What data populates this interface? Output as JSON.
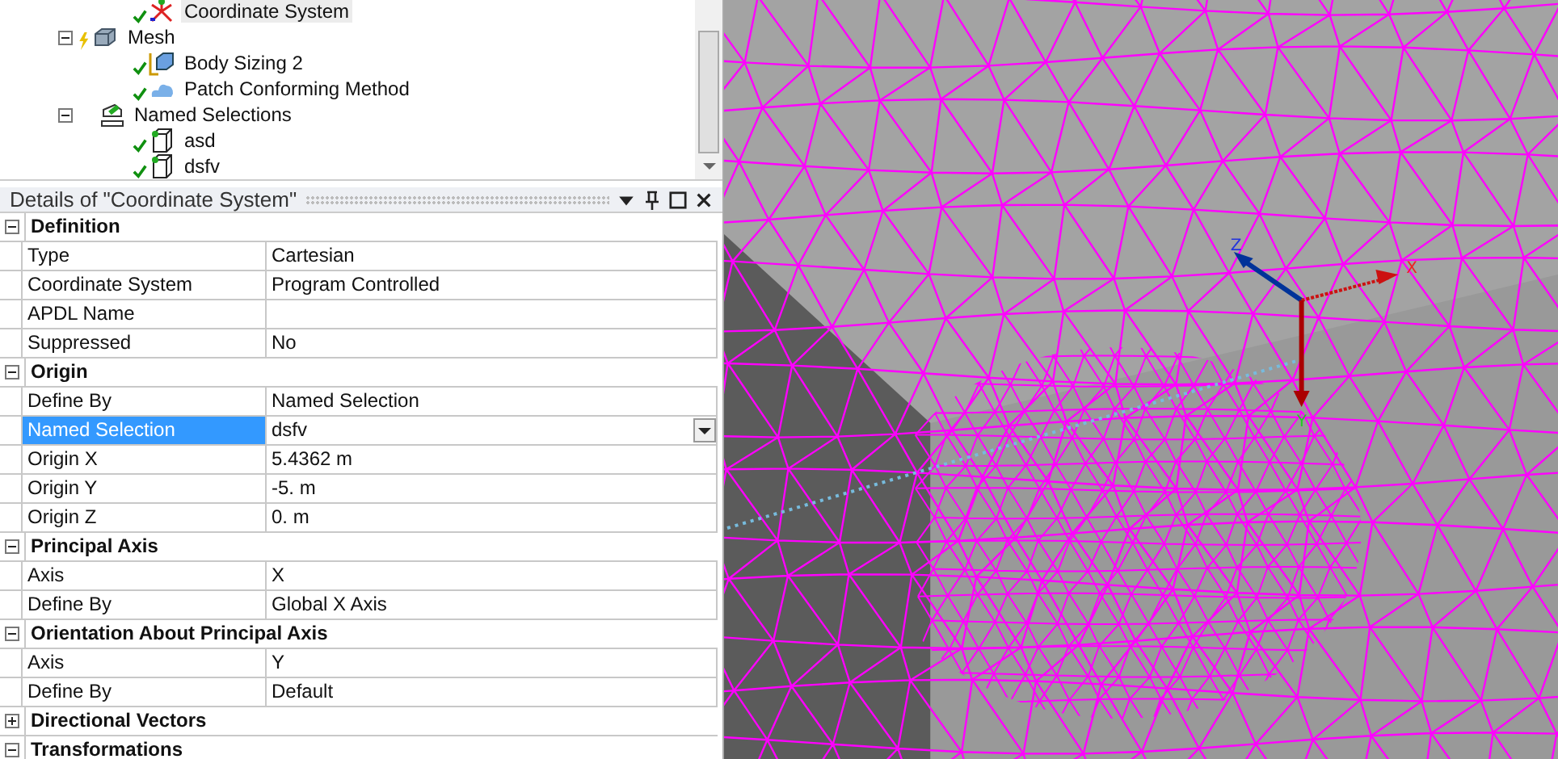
{
  "tree": {
    "items": [
      {
        "children": [
          {
            "label": "Coordinate System",
            "kind": "coordinate-system",
            "selected": true
          }
        ]
      },
      {
        "label": "Mesh",
        "kind": "mesh",
        "expanded": true,
        "selected": false,
        "children": [
          {
            "label": "Body Sizing 2",
            "kind": "sizing",
            "selected": false
          },
          {
            "label": "Patch Conforming Method",
            "kind": "method",
            "selected": false
          }
        ]
      },
      {
        "label": "Named Selections",
        "kind": "folder",
        "expanded": true,
        "selected": false,
        "children": [
          {
            "label": "asd",
            "kind": "selection",
            "selected": false
          },
          {
            "label": "dsfv",
            "kind": "selection",
            "selected": false
          }
        ]
      }
    ]
  },
  "details": {
    "title": "Details of \"Coordinate System\"",
    "rows": [
      {
        "kind": "group",
        "label": "Definition",
        "expanded": true
      },
      {
        "kind": "prop",
        "label": "Type",
        "value": "Cartesian",
        "selected": false
      },
      {
        "kind": "prop",
        "label": "Coordinate System",
        "value": "Program Controlled",
        "selected": false
      },
      {
        "kind": "prop",
        "label": "APDL Name",
        "selected": false
      },
      {
        "kind": "prop",
        "label": "Suppressed",
        "value": "No",
        "selected": false
      },
      {
        "kind": "group",
        "label": "Origin",
        "expanded": true
      },
      {
        "kind": "prop",
        "label": "Define By",
        "value": "Named Selection",
        "selected": false
      },
      {
        "kind": "dropdown",
        "label": "Named Selection",
        "value": "dsfv",
        "selected": true
      },
      {
        "kind": "prop",
        "label": "Origin X",
        "value": "5.4362 m",
        "selected": false
      },
      {
        "kind": "prop",
        "label": "Origin Y",
        "value": "-5. m",
        "selected": false
      },
      {
        "kind": "prop",
        "label": "Origin Z",
        "value": "0. m",
        "selected": false
      },
      {
        "kind": "group",
        "label": "Principal Axis",
        "expanded": true
      },
      {
        "kind": "prop",
        "label": "Axis",
        "value": "X",
        "selected": false
      },
      {
        "kind": "prop",
        "label": "Define By",
        "value": "Global X Axis",
        "selected": false
      },
      {
        "kind": "group",
        "label": "Orientation About Principal Axis",
        "expanded": true
      },
      {
        "kind": "prop",
        "label": "Axis",
        "value": "Y",
        "selected": false
      },
      {
        "kind": "prop",
        "label": "Define By",
        "value": "Default",
        "selected": false
      },
      {
        "kind": "group",
        "label": "Directional Vectors",
        "expanded": false
      },
      {
        "kind": "group",
        "label": "Transformations",
        "expanded": true
      }
    ]
  },
  "viewport": {
    "triad": {
      "x": "X",
      "y": "Y",
      "z": "Z"
    }
  }
}
